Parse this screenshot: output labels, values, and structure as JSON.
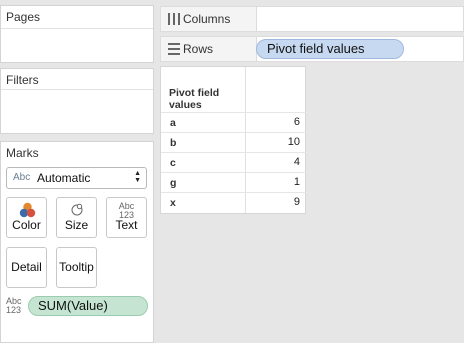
{
  "pages_panel": {
    "title": "Pages"
  },
  "filters_panel": {
    "title": "Filters"
  },
  "marks_panel": {
    "title": "Marks",
    "mark_type": "Automatic",
    "mark_type_icon_text": "Abc",
    "buttons": [
      {
        "label": "Color",
        "icon": "color-icon"
      },
      {
        "label": "Size",
        "icon": "size-icon"
      },
      {
        "label": "Text",
        "icon": "text-icon"
      },
      {
        "label": "Detail",
        "icon": ""
      },
      {
        "label": "Tooltip",
        "icon": ""
      }
    ],
    "text_icon_top": "Abc",
    "text_icon_bottom": "123",
    "field_icon_top": "Abc",
    "field_icon_bottom": "123",
    "field_pill": "SUM(Value)"
  },
  "shelves": {
    "columns_label": "Columns",
    "rows_label": "Rows",
    "rows_pill": "Pivot field values"
  },
  "table": {
    "header_line1": "Pivot field",
    "header_line2": "values",
    "rows": [
      {
        "key": "a",
        "value": "6"
      },
      {
        "key": "b",
        "value": "10"
      },
      {
        "key": "c",
        "value": "4"
      },
      {
        "key": "g",
        "value": "1"
      },
      {
        "key": "x",
        "value": "9"
      }
    ]
  },
  "colors": {
    "rows_pill": "#c6d9f1",
    "measure_pill": "#c5e5d2",
    "color_icon_top": "#e2892e",
    "color_icon_bottom": "#3d6aa8"
  }
}
